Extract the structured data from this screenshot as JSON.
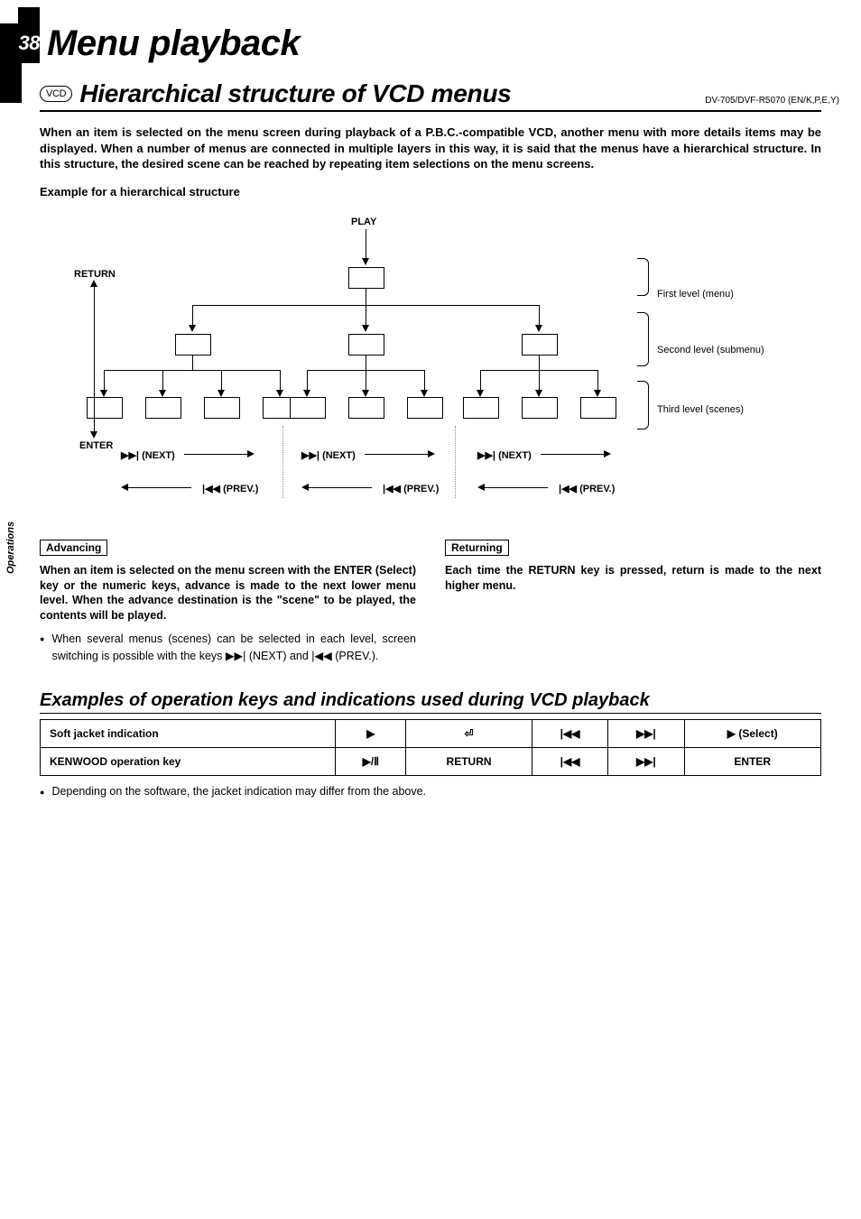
{
  "page": {
    "number": "38",
    "title": "Menu playback",
    "doc_id": "DV-705/DVF-R5070 (EN/K,P,E,Y)",
    "side_label": "Operations"
  },
  "section": {
    "badge": "VCD",
    "title": "Hierarchical structure of VCD menus",
    "intro": "When an item is selected on the menu screen during playback of a P.B.C.-compatible VCD, another menu with more details items may be displayed. When a number of menus are connected in multiple layers in this way, it is said that the menus have a hierarchical structure. In this structure, the desired scene can be reached by repeating item selections on the menu screens.",
    "example_label": "Example for a hierarchical structure"
  },
  "diagram": {
    "play": "PLAY",
    "return": "RETURN",
    "enter": "ENTER",
    "next": "(NEXT)",
    "prev": "(PREV.)",
    "level1": "First level (menu)",
    "level2": "Second level (submenu)",
    "level3": "Third level (scenes)"
  },
  "advancing": {
    "label": "Advancing",
    "text": "When an item is selected on the menu screen with the ENTER (Select) key or the numeric keys, advance is made to the next lower menu level. When the advance destination is the \"scene\" to be played, the contents will be played.",
    "bullet": "When several menus (scenes) can be selected in each level, screen switching is possible with the keys ▶▶| (NEXT) and |◀◀ (PREV.)."
  },
  "returning": {
    "label": "Returning",
    "text": "Each time the RETURN key is pressed, return is made to the next higher menu."
  },
  "subsection": "Examples of operation keys and indications used during VCD playback",
  "table": {
    "r1": {
      "c1": "Soft jacket indication",
      "c2": "▶",
      "c3": "⏎",
      "c4": "|◀◀",
      "c5": "▶▶|",
      "c6": "▶ (Select)"
    },
    "r2": {
      "c1": "KENWOOD operation key",
      "c2": "▶/Ⅱ",
      "c3": "RETURN",
      "c4": "|◀◀",
      "c5": "▶▶|",
      "c6": "ENTER"
    }
  },
  "note": "Depending on the software, the jacket indication may differ from the above."
}
